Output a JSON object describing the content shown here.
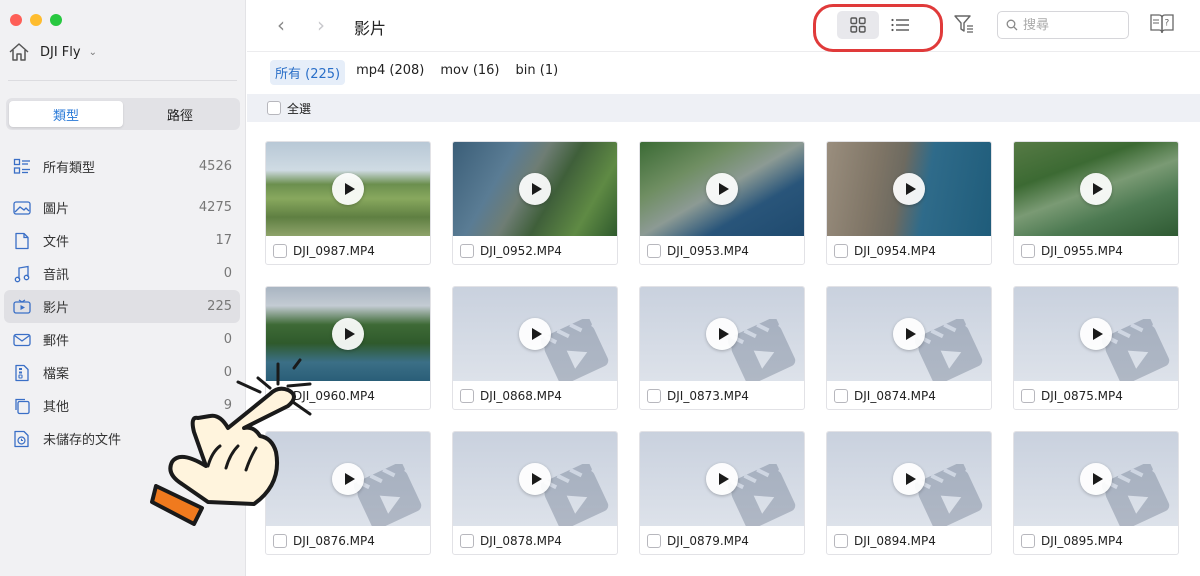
{
  "sidebar": {
    "device_name": "DJI Fly",
    "seg_tabs": [
      {
        "label": "類型",
        "active": true
      },
      {
        "label": "路徑",
        "active": false
      }
    ],
    "items": [
      {
        "label": "所有類型",
        "count": "4526",
        "icon": "grid-list-icon"
      },
      {
        "label": "圖片",
        "count": "4275",
        "icon": "image-icon"
      },
      {
        "label": "文件",
        "count": "17",
        "icon": "document-icon"
      },
      {
        "label": "音訊",
        "count": "0",
        "icon": "music-note-icon"
      },
      {
        "label": "影片",
        "count": "225",
        "icon": "video-icon",
        "selected": true
      },
      {
        "label": "郵件",
        "count": "0",
        "icon": "mail-icon"
      },
      {
        "label": "檔案",
        "count": "0",
        "icon": "archive-icon"
      },
      {
        "label": "其他",
        "count": "9",
        "icon": "copy-icon"
      },
      {
        "label": "未儲存的文件",
        "count": "",
        "icon": "clock-icon"
      }
    ]
  },
  "toolbar": {
    "title": "影片",
    "back": "‹",
    "forward": "›",
    "search_placeholder": "搜尋"
  },
  "filters": [
    {
      "label": "所有 (225)",
      "active": true
    },
    {
      "label": "mp4 (208)",
      "active": false
    },
    {
      "label": "mov (16)",
      "active": false
    },
    {
      "label": "bin (1)",
      "active": false
    }
  ],
  "select_all": "全選",
  "files": [
    {
      "name": "DJI_0987.MP4",
      "thumb": "ph1"
    },
    {
      "name": "DJI_0952.MP4",
      "thumb": "ph2"
    },
    {
      "name": "DJI_0953.MP4",
      "thumb": "ph3"
    },
    {
      "name": "DJI_0954.MP4",
      "thumb": "ph4"
    },
    {
      "name": "DJI_0955.MP4",
      "thumb": "ph5"
    },
    {
      "name": "DJI_0960.MP4",
      "thumb": "ph6"
    },
    {
      "name": "DJI_0868.MP4",
      "thumb": "placeholder"
    },
    {
      "name": "DJI_0873.MP4",
      "thumb": "placeholder"
    },
    {
      "name": "DJI_0874.MP4",
      "thumb": "placeholder"
    },
    {
      "name": "DJI_0875.MP4",
      "thumb": "placeholder"
    },
    {
      "name": "DJI_0876.MP4",
      "thumb": "placeholder"
    },
    {
      "name": "DJI_0878.MP4",
      "thumb": "placeholder"
    },
    {
      "name": "DJI_0879.MP4",
      "thumb": "placeholder"
    },
    {
      "name": "DJI_0894.MP4",
      "thumb": "placeholder"
    },
    {
      "name": "DJI_0895.MP4",
      "thumb": "placeholder"
    }
  ],
  "colors": {
    "accent": "#2a7ad8",
    "highlight_ring": "#e03a3a",
    "hand_cuff": "#f07a1e",
    "hand_fill": "#fff4dd"
  }
}
